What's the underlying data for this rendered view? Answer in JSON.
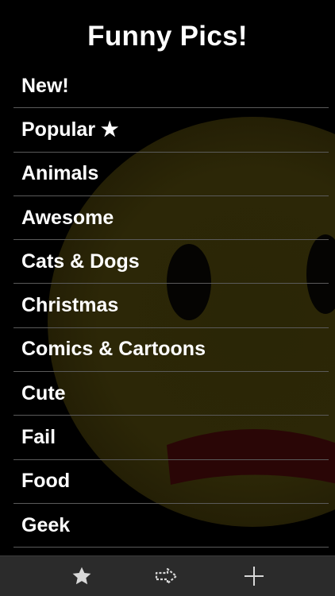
{
  "header": {
    "title": "Funny Pics!"
  },
  "categories": [
    {
      "label": "New!"
    },
    {
      "label": "Popular ★"
    },
    {
      "label": "Animals"
    },
    {
      "label": "Awesome"
    },
    {
      "label": "Cats & Dogs"
    },
    {
      "label": "Christmas"
    },
    {
      "label": "Comics & Cartoons"
    },
    {
      "label": "Cute"
    },
    {
      "label": "Fail"
    },
    {
      "label": "Food"
    },
    {
      "label": "Geek"
    }
  ],
  "tabbar": {
    "items": [
      {
        "icon": "star-icon"
      },
      {
        "icon": "share-arrow-icon"
      },
      {
        "icon": "plus-icon"
      }
    ]
  },
  "colors": {
    "background": "#000000",
    "text": "#ffffff",
    "divider": "#5a5a5a",
    "tabbar": "#2b2b2b",
    "smiley_yellow": "#e0c400",
    "smiley_mouth": "#c41a1a"
  }
}
